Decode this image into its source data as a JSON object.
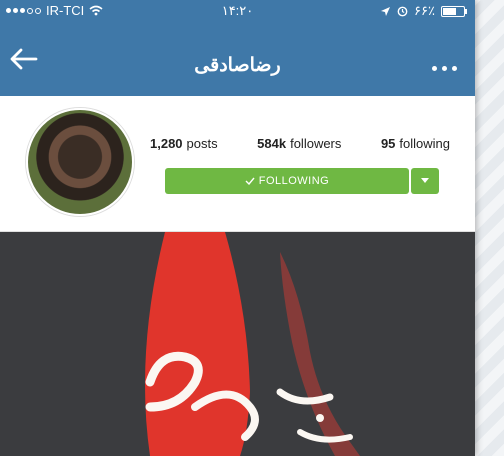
{
  "status_bar": {
    "carrier": "IR-TCI",
    "time": "۱۴:۲۰",
    "battery_text": "۶۶٪",
    "signal_bars_filled": 3,
    "signal_bars_total": 5,
    "battery_level": 0.66
  },
  "navbar": {
    "title": "رضاصادقی",
    "back_icon": "arrow-left-icon",
    "more_icon": "more-dots-icon"
  },
  "profile": {
    "stats": {
      "posts_count": "1,280",
      "posts_label": "posts",
      "followers_count": "584k",
      "followers_label": "followers",
      "following_count": "95",
      "following_label": "following"
    },
    "follow_button_label": "FOLLOWING",
    "follow_button_icon": "check-icon",
    "dropdown_icon": "caret-down-icon",
    "accent_color": "#6fb843"
  },
  "colors": {
    "nav_bg": "#3f78a8",
    "image_bg": "#3b3c3f",
    "flag_red": "#e0352c"
  }
}
